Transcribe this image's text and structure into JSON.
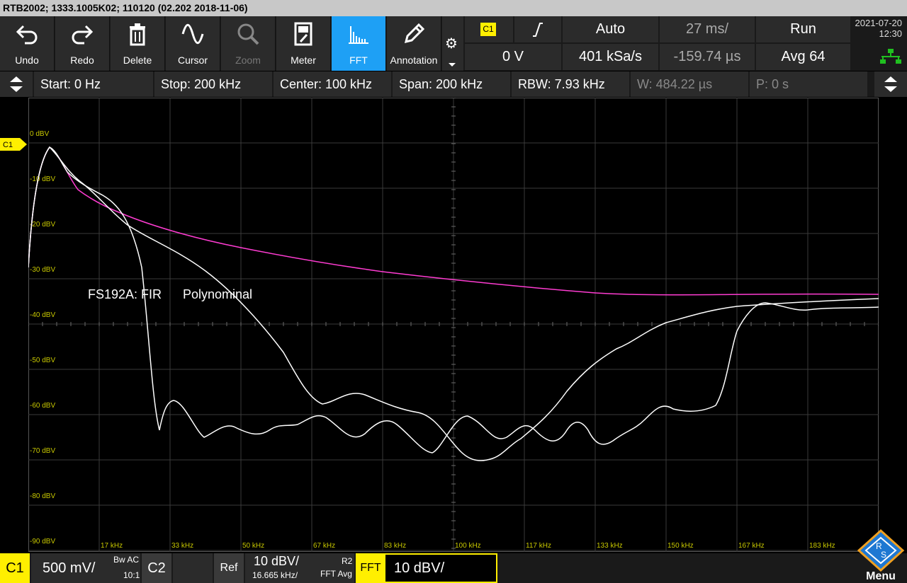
{
  "title": "RTB2002; 1333.1005K02; 110120 (02.202 2018-11-06)",
  "toolbar": {
    "undo": "Undo",
    "redo": "Redo",
    "delete": "Delete",
    "cursor": "Cursor",
    "zoom": "Zoom",
    "meter": "Meter",
    "fft": "FFT",
    "annotation": "Annotation"
  },
  "trigger": {
    "source": "C1",
    "slope_icon": "rising-edge-icon",
    "level": "0 V",
    "mode": "Auto",
    "sample_rate": "401 kSa/s",
    "timebase": "27 ms/",
    "position": "-159.74 µs",
    "run_state": "Run",
    "acquisition": "Avg 64"
  },
  "datetime": {
    "date": "2021-07-20",
    "time": "12:30"
  },
  "fft": {
    "start": "Start: 0 Hz",
    "stop": "Stop: 200 kHz",
    "center": "Center: 100 kHz",
    "span": "Span: 200 kHz",
    "rbw": "RBW: 7.93 kHz",
    "window": "W: 484.22 µs",
    "position": "P: 0 s"
  },
  "plot": {
    "marker": "C1",
    "y_labels": [
      "0 dBV",
      "-10 dBV",
      "-20 dBV",
      "-30 dBV",
      "-40 dBV",
      "-50 dBV",
      "-60 dBV",
      "-70 dBV",
      "-80 dBV",
      "-90 dBV"
    ],
    "x_labels": [
      "17 kHz",
      "33 kHz",
      "50 kHz",
      "67 kHz",
      "83 kHz",
      "100 kHz",
      "117 kHz",
      "133 kHz",
      "150 kHz",
      "167 kHz",
      "183 kHz"
    ],
    "annotations": [
      "FS192A: FIR",
      "Polynominal"
    ],
    "trace_colors": {
      "signal": "#ffffff",
      "reference": "#ff3cd2",
      "grid": "#3a3a3a",
      "labels": "#c8c800"
    }
  },
  "bottom": {
    "ch1": "C1",
    "ch1_scale": "500 mV/",
    "bw": "Bw AC",
    "probe": "10:1",
    "ch2": "C2",
    "ref": "Ref",
    "ref_scale": "10 dBV/",
    "ref_freq": "16.665 kHz/",
    "r2": "R2",
    "fft_avg": "FFT Avg",
    "fft_label": "FFT",
    "fft_scale": "10 dBV/",
    "menu": "Menu"
  }
}
